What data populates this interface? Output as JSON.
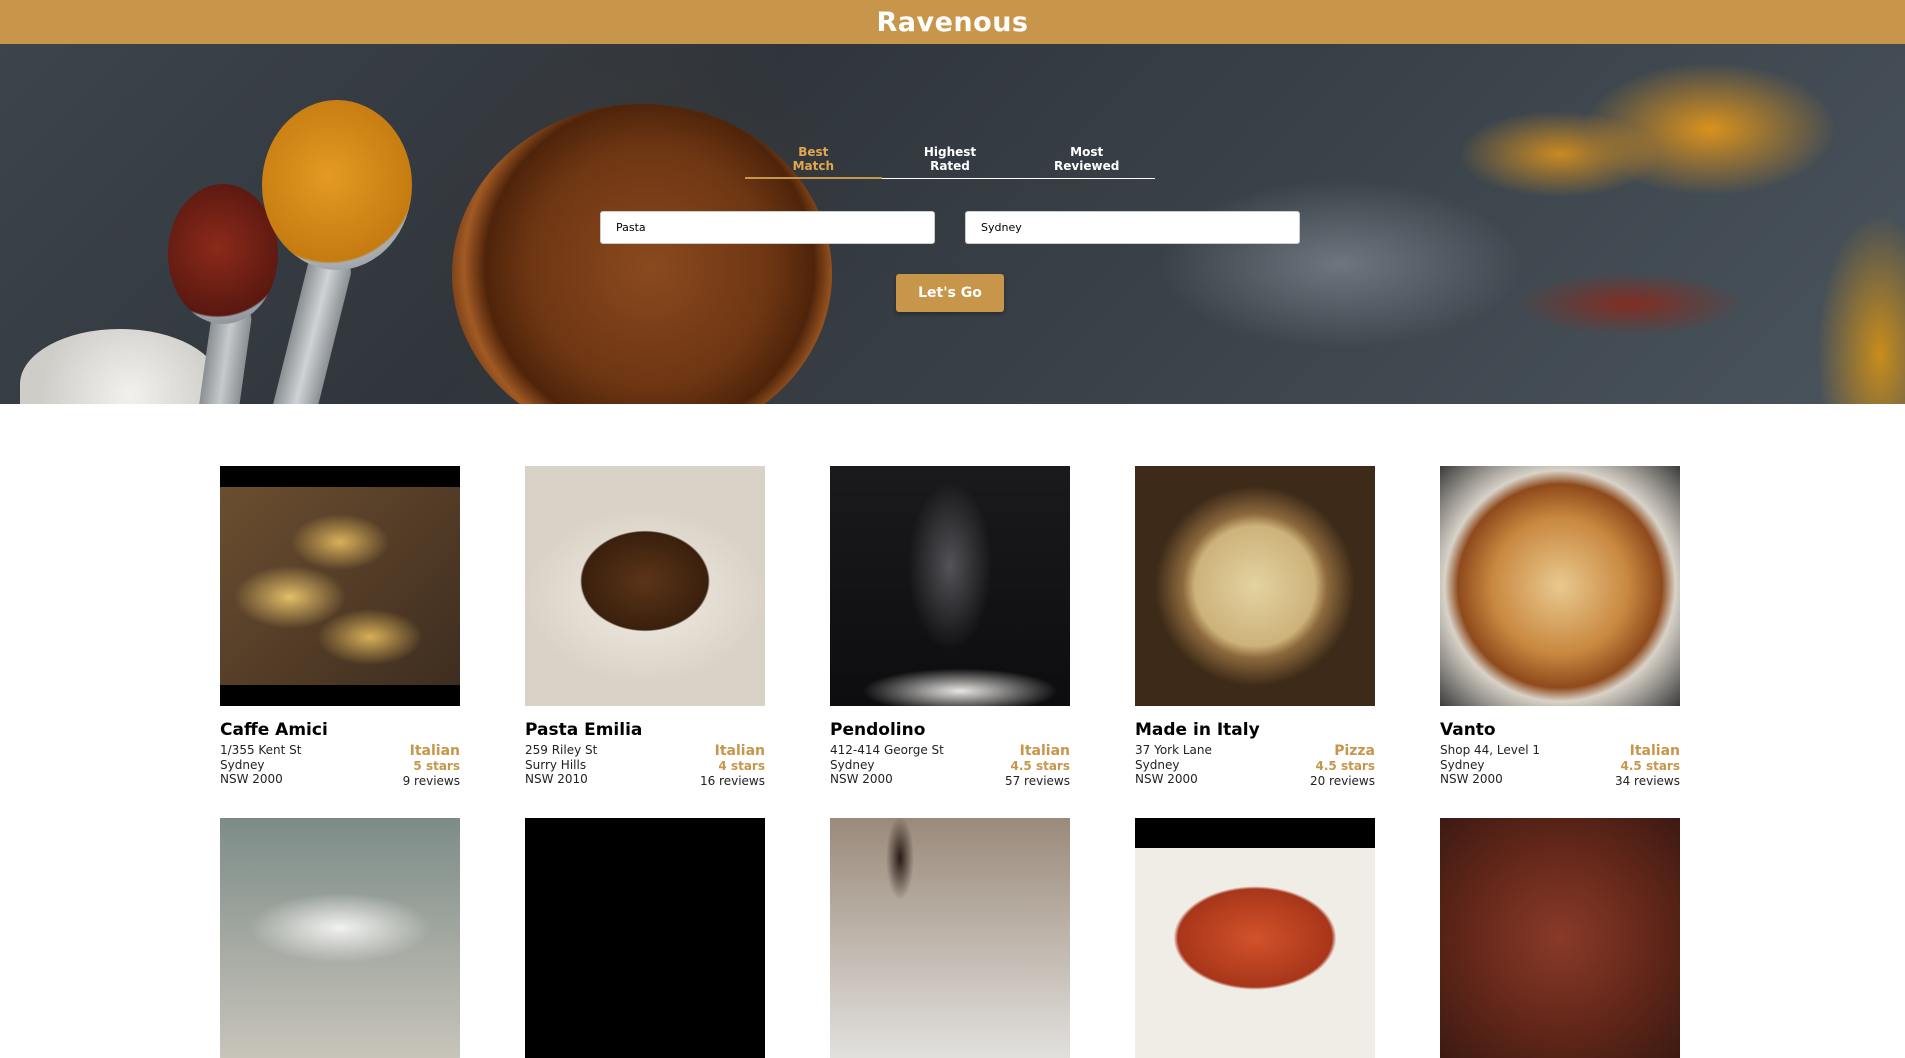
{
  "app": {
    "title": "Ravenous"
  },
  "search": {
    "tabs": [
      {
        "label": "Best\nMatch",
        "line1": "Best",
        "line2": "Match",
        "active": true
      },
      {
        "label": "Highest\nRated",
        "line1": "Highest",
        "line2": "Rated",
        "active": false
      },
      {
        "label": "Most\nReviewed",
        "line1": "Most",
        "line2": "Reviewed",
        "active": false
      }
    ],
    "term_value": "Pasta",
    "location_value": "Sydney",
    "submit_label": "Let's Go"
  },
  "businesses": [
    {
      "name": "Caffe Amici",
      "address": "1/355 Kent St",
      "city": "Sydney",
      "state_zip": "NSW 2000",
      "category": "Italian",
      "rating": "5 stars",
      "reviews": "9 reviews"
    },
    {
      "name": "Pasta Emilia",
      "address": "259 Riley St",
      "city": "Surry Hills",
      "state_zip": "NSW 2010",
      "category": "Italian",
      "rating": "4 stars",
      "reviews": "16 reviews"
    },
    {
      "name": "Pendolino",
      "address": "412-414 George St",
      "city": "Sydney",
      "state_zip": "NSW 2000",
      "category": "Italian",
      "rating": "4.5 stars",
      "reviews": "57 reviews"
    },
    {
      "name": "Made in Italy",
      "address": "37 York Lane",
      "city": "Sydney",
      "state_zip": "NSW 2000",
      "category": "Pizza",
      "rating": "4.5 stars",
      "reviews": "20 reviews"
    },
    {
      "name": "Vanto",
      "address": "Shop 44, Level 1",
      "city": "Sydney",
      "state_zip": "NSW 2000",
      "category": "Italian",
      "rating": "4.5 stars",
      "reviews": "34 reviews"
    }
  ],
  "theme": {
    "accent": "#c8964a"
  }
}
